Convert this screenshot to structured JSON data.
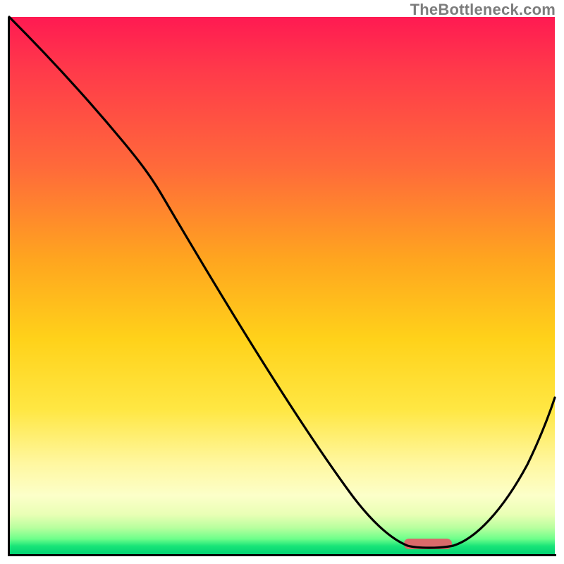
{
  "watermark": "TheBottleneck.com",
  "colors": {
    "gradient_top": "#ff1a52",
    "gradient_mid1": "#ffa51f",
    "gradient_mid2": "#ffe743",
    "gradient_bottom": "#00d172",
    "curve": "#000000",
    "marker": "#d96a6a",
    "axis": "#000000"
  },
  "chart_data": {
    "type": "line",
    "title": "",
    "xlabel": "",
    "ylabel": "",
    "xlim": [
      0,
      100
    ],
    "ylim": [
      0,
      100
    ],
    "grid": false,
    "series": [
      {
        "name": "curve",
        "x": [
          0,
          8,
          16,
          22,
          27,
          35,
          45,
          55,
          62,
          68,
          72,
          75,
          78,
          82,
          86,
          90,
          94,
          100
        ],
        "y": [
          100,
          91,
          82,
          75,
          68,
          55,
          38,
          22,
          12,
          5,
          2,
          1,
          1,
          2,
          6,
          12,
          20,
          34
        ]
      }
    ],
    "marker": {
      "x": 76,
      "y": 1,
      "width": 6,
      "height": 1.5
    },
    "notes": "y is a relative 0–100 scale; minimum (optimal point) sits near x≈75–80 at the green band."
  }
}
